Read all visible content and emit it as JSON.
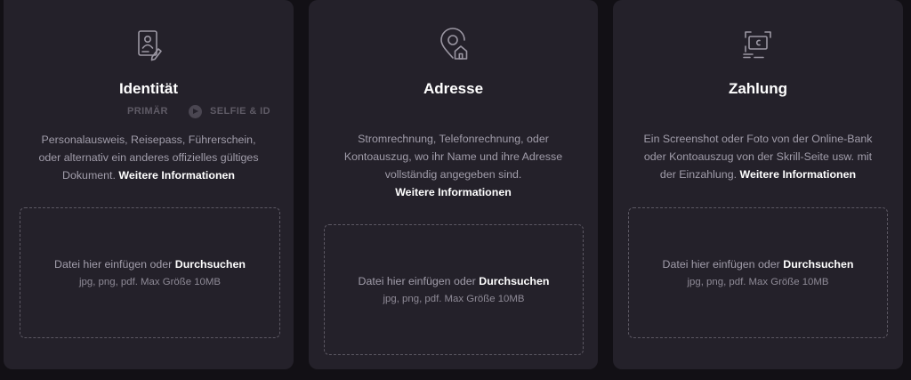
{
  "cards": [
    {
      "icon": "id-document-icon",
      "title": "Identität",
      "steps": [
        "PRIMÄR",
        "SELFIE & ID"
      ],
      "description_lines": [
        "Personalausweis, Reisepass, Führerschein,",
        "oder alternativ ein anderes offizielles gültiges",
        "Dokument."
      ],
      "more_link": "Weitere Informationen",
      "drop": {
        "text": "Datei hier einfügen oder",
        "browse": "Durchsuchen",
        "hint": "jpg, png, pdf. Max Größe 10MB"
      }
    },
    {
      "icon": "location-home-icon",
      "title": "Adresse",
      "description_lines": [
        "Stromrechnung, Telefonrechnung, oder",
        "Kontoauszug, wo ihr Name und ihre Adresse",
        "vollständig angegeben sind."
      ],
      "more_link": "Weitere Informationen",
      "drop": {
        "text": "Datei hier einfügen oder",
        "browse": "Durchsuchen",
        "hint": "jpg, png, pdf. Max Größe 10MB"
      }
    },
    {
      "icon": "payment-screenshot-icon",
      "title": "Zahlung",
      "description_lines": [
        "Ein Screenshot oder Foto von der Online-Bank",
        "oder Kontoauszug von der Skrill-Seite usw. mit",
        "der Einzahlung."
      ],
      "more_link": "Weitere Informationen",
      "drop": {
        "text": "Datei hier einfügen oder",
        "browse": "Durchsuchen",
        "hint": "jpg, png, pdf. Max Größe 10MB"
      }
    }
  ]
}
